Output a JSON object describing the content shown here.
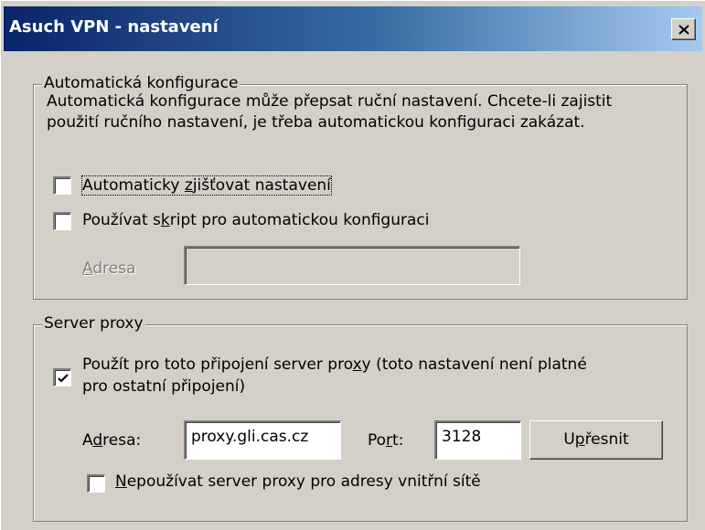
{
  "window": {
    "title": "Asuch VPN - nastavení",
    "close_glyph": "close-icon"
  },
  "auto_config": {
    "legend": "Automatická konfigurace",
    "description": "Automatická konfigurace může přepsat ruční nastavení. Chcete-li zajistit použití ručního nastavení, je třeba automatickou konfiguraci zakázat.",
    "auto_detect": {
      "label_pre": "Automaticky ",
      "label_accel": "z",
      "label_post": "jišťovat nastavení",
      "checked": false
    },
    "use_script": {
      "label_pre": "Používat s",
      "label_accel": "k",
      "label_post": "ript pro automatickou konfiguraci",
      "checked": false
    },
    "address": {
      "label_accel": "A",
      "label_post": "dresa",
      "value": ""
    }
  },
  "proxy": {
    "legend": "Server proxy",
    "use_proxy": {
      "label_line1_pre": "Použít pro toto připojení server pro",
      "label_line1_accel": "x",
      "label_line1_post": "y (toto nastavení není platné",
      "label_line2": "pro ostatní připojení)",
      "checked": true
    },
    "address": {
      "label_pre": "A",
      "label_accel": "d",
      "label_post": "resa:",
      "value": "proxy.gli.cas.cz"
    },
    "port": {
      "label_pre": "Po",
      "label_accel": "r",
      "label_post": "t:",
      "value": "3128"
    },
    "advanced_button": {
      "label_pre": "U",
      "label_accel": "p",
      "label_post": "řesnit"
    },
    "bypass_local": {
      "label_accel": "N",
      "label_post": "epoužívat server proxy pro adresy vnitřní sítě",
      "checked": false
    }
  },
  "colors": {
    "title_gradient_start": "#0a246a",
    "title_gradient_end": "#a6caf0",
    "dialog_face": "#d4d0c8"
  }
}
